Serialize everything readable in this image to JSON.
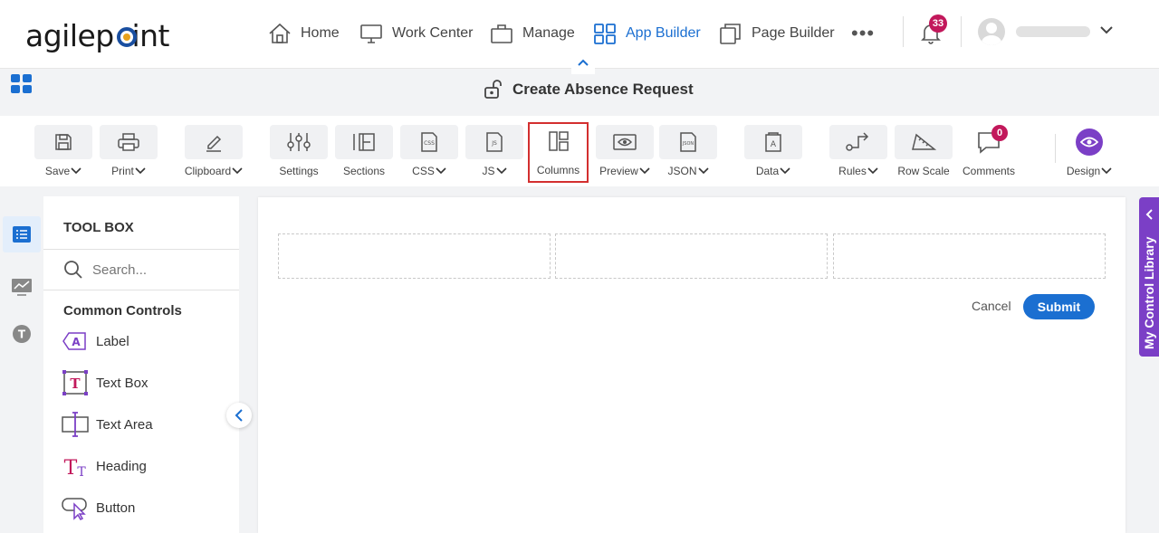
{
  "app": {
    "logo_text": "agilepoint",
    "page_title": "Create Absence Request"
  },
  "nav": {
    "items": [
      {
        "label": "Home",
        "icon": "home-icon"
      },
      {
        "label": "Work Center",
        "icon": "monitor-icon"
      },
      {
        "label": "Manage",
        "icon": "briefcase-icon"
      },
      {
        "label": "App Builder",
        "icon": "grid-icon",
        "active": true
      },
      {
        "label": "Page Builder",
        "icon": "copy-icon"
      }
    ],
    "more": "•••",
    "notifications_count": "33"
  },
  "toolbar": {
    "items": [
      {
        "label": "Save",
        "dropdown": true,
        "icon": "save-icon"
      },
      {
        "label": "Print",
        "dropdown": true,
        "icon": "print-icon"
      },
      {
        "label": "Clipboard",
        "dropdown": true,
        "icon": "pencil-icon"
      },
      {
        "label": "Settings",
        "dropdown": false,
        "icon": "sliders-icon"
      },
      {
        "label": "Sections",
        "dropdown": false,
        "icon": "sections-icon"
      },
      {
        "label": "CSS",
        "dropdown": true,
        "icon": "css-file-icon"
      },
      {
        "label": "JS",
        "dropdown": true,
        "icon": "js-file-icon"
      },
      {
        "label": "Columns",
        "dropdown": false,
        "icon": "columns-icon",
        "highlighted": true
      },
      {
        "label": "Preview",
        "dropdown": true,
        "icon": "eye-icon"
      },
      {
        "label": "JSON",
        "dropdown": true,
        "icon": "json-file-icon"
      },
      {
        "label": "Data",
        "dropdown": true,
        "icon": "data-icon"
      },
      {
        "label": "Rules",
        "dropdown": true,
        "icon": "rules-icon"
      },
      {
        "label": "Row Scale",
        "dropdown": false,
        "icon": "ruler-icon"
      },
      {
        "label": "Comments",
        "dropdown": false,
        "icon": "comment-icon",
        "badge": "0"
      },
      {
        "label": "Design",
        "dropdown": true,
        "icon": "design-eye-icon"
      }
    ]
  },
  "toolbox": {
    "title": "TOOL BOX",
    "search_placeholder": "Search...",
    "section_title": "Common Controls",
    "controls": [
      {
        "label": "Label",
        "icon": "label-icon"
      },
      {
        "label": "Text Box",
        "icon": "textbox-icon"
      },
      {
        "label": "Text Area",
        "icon": "textarea-icon"
      },
      {
        "label": "Heading",
        "icon": "heading-icon"
      },
      {
        "label": "Button",
        "icon": "button-icon"
      }
    ]
  },
  "form": {
    "cancel_label": "Cancel",
    "submit_label": "Submit"
  },
  "right_panel": {
    "label": "My Control Library"
  },
  "colors": {
    "accent": "#1b6fd1",
    "purple": "#7b3fc6",
    "badge": "#c2185b",
    "highlight": "#d32f2f"
  }
}
